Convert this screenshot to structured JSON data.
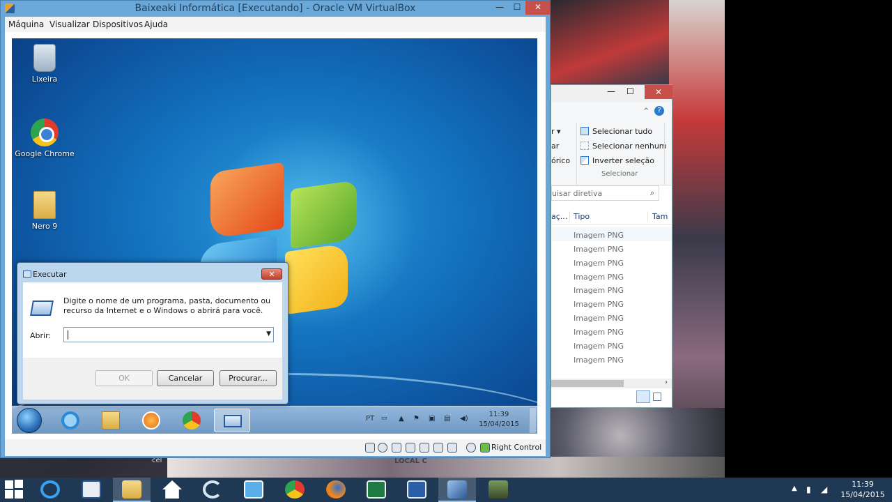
{
  "host": {
    "bg_text_cel": "cel",
    "bg_text_local": "LOCAL C"
  },
  "vbox": {
    "title": "Baixeaki Informática [Executando] - Oracle VM VirtualBox",
    "controls": {
      "minimize": "—",
      "maximize": "☐",
      "close": "✕"
    },
    "menu": [
      "Máquina",
      "Visualizar",
      "Dispositivos",
      "Ajuda"
    ],
    "status": {
      "host_key": "Right Control"
    }
  },
  "guest": {
    "desktop_icons": [
      {
        "label": "Lixeira",
        "icon": "recycle-bin-icon"
      },
      {
        "label": "Google Chrome",
        "icon": "chrome-icon"
      },
      {
        "label": "Nero 9",
        "icon": "folder-icon"
      }
    ],
    "taskbar": {
      "lang": "PT",
      "time": "11:39",
      "date": "15/04/2015"
    }
  },
  "run_dialog": {
    "title": "Executar",
    "close": "✕",
    "description": "Digite o nome de um programa, pasta, documento ou recurso da Internet e o Windows o abrirá para você.",
    "open_label": "Abrir:",
    "input_value": "",
    "buttons": {
      "ok": "OK",
      "cancel": "Cancelar",
      "browse": "Procurar..."
    }
  },
  "explorer": {
    "controls": {
      "minimize": "—",
      "maximize": "☐",
      "close": "✕"
    },
    "ribbon": {
      "left_fragments": [
        "r ▾",
        "ar",
        "órico"
      ],
      "select_all": "Selecionar tudo",
      "select_none": "Selecionar nenhum",
      "invert": "Inverter seleção",
      "group": "Selecionar"
    },
    "search_placeholder": "uisar diretiva",
    "columns": {
      "left_fragment": "aç...",
      "type": "Tipo",
      "size_fragment": "Tam"
    },
    "rows": [
      "Imagem PNG",
      "Imagem PNG",
      "Imagem PNG",
      "Imagem PNG",
      "Imagem PNG",
      "Imagem PNG",
      "Imagem PNG",
      "Imagem PNG",
      "Imagem PNG",
      "Imagem PNG"
    ]
  },
  "host_taskbar": {
    "time": "11:39",
    "date": "15/04/2015",
    "apps": [
      "start-icon",
      "internet-explorer-icon",
      "lenovo-icon",
      "file-explorer-icon",
      "home-icon",
      "skype-icon",
      "mail-icon",
      "chrome-icon",
      "firefox-icon",
      "excel-icon",
      "word-icon",
      "virtualbox-icon",
      "app-icon"
    ]
  }
}
